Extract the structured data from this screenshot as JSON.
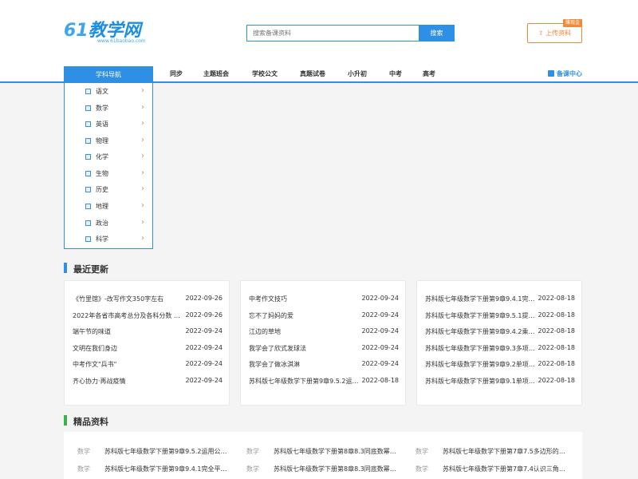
{
  "header": {
    "logo_text": "教学网",
    "logo_number": "61",
    "logo_url": "www.61baobao.com",
    "search_placeholder": "搜索备课资料",
    "search_button": "搜索",
    "upload_label": "⇪ 上传资料",
    "upload_badge": "赚现金"
  },
  "nav": {
    "subject_nav": "学科导航",
    "items": [
      "同步",
      "主题班会",
      "学校公文",
      "真题试卷",
      "小升初",
      "中考",
      "高考"
    ],
    "right_link": "备课中心"
  },
  "subjects": [
    "语文",
    "数学",
    "英语",
    "物理",
    "化学",
    "生物",
    "历史",
    "地理",
    "政治",
    "科学"
  ],
  "recent": {
    "title": "最近更新",
    "columns": [
      [
        {
          "title": "《竹里馆》-改写作文350字左右",
          "date": "2022-09-26"
        },
        {
          "title": "2022年各省市高考总分及各科分数 分...",
          "date": "2022-09-26"
        },
        {
          "title": "端午节的味道",
          "date": "2022-09-24"
        },
        {
          "title": "文明在我们身边",
          "date": "2022-09-24"
        },
        {
          "title": "中考作文\"兵书\"",
          "date": "2022-09-24"
        },
        {
          "title": "齐心协力·再战疫情",
          "date": "2022-09-24"
        }
      ],
      [
        {
          "title": "中考作文技巧",
          "date": "2022-09-24"
        },
        {
          "title": "忘不了妈妈的爱",
          "date": "2022-09-24"
        },
        {
          "title": "江边的草地",
          "date": "2022-09-24"
        },
        {
          "title": "我学会了欣式发球法",
          "date": "2022-09-24"
        },
        {
          "title": "我学会了做冰淇淋",
          "date": "2022-09-24"
        },
        {
          "title": "苏科版七年级数学下册第9章9.5.2运用...",
          "date": "2022-08-18"
        }
      ],
      [
        {
          "title": "苏科版七年级数学下册第9章9.4.1完全...",
          "date": "2022-08-18"
        },
        {
          "title": "苏科版七年级数学下册第9章9.5.1提公...",
          "date": "2022-08-18"
        },
        {
          "title": "苏科版七年级数学下册第9章9.4.2乘法...",
          "date": "2022-08-18"
        },
        {
          "title": "苏科版七年级数学下册第9章9.3多项式...",
          "date": "2022-08-18"
        },
        {
          "title": "苏科版七年级数学下册第9章9.2单项式...",
          "date": "2022-08-18"
        },
        {
          "title": "苏科版七年级数学下册第9章9.1单项式...",
          "date": "2022-08-18"
        }
      ]
    ]
  },
  "best": {
    "title": "精品资料",
    "rows": [
      [
        {
          "cat": "数学",
          "title": "苏科版七年级数学下册第9章9.5.2运用公式..."
        },
        {
          "cat": "数学",
          "title": "苏科版七年级数学下册第8章8.3同底数幂的..."
        },
        {
          "cat": "数学",
          "title": "苏科版七年级数学下册第7章7.5多边形的内..."
        }
      ],
      [
        {
          "cat": "数学",
          "title": "苏科版七年级数学下册第9章9.4.1完全平方..."
        },
        {
          "cat": "数学",
          "title": "苏科版七年级数学下册第8章8.3同底数幂的..."
        },
        {
          "cat": "数学",
          "title": "苏科版七年级数学下册第7章7.4认识三角形..."
        }
      ]
    ]
  },
  "colors": {
    "primary": "#2d8fe6",
    "orange": "#f08a3a",
    "green": "#3cb34a"
  }
}
